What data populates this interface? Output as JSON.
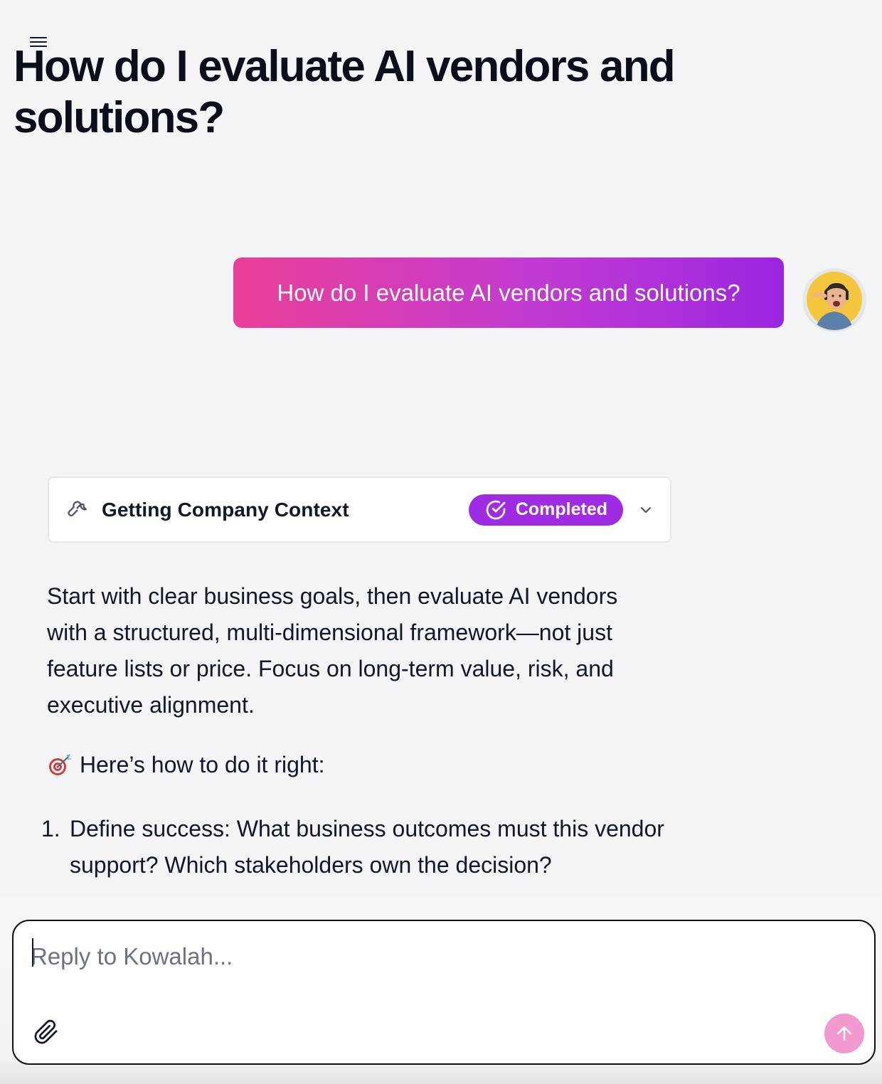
{
  "page": {
    "title": "How do I evaluate AI vendors and solutions?"
  },
  "header": {
    "menu_icon": "hamburger-menu-icon"
  },
  "conversation": {
    "user_message": "How do I evaluate AI vendors and solutions?",
    "user_avatar": "user-avatar-photo",
    "tool_call": {
      "icon": "wrench-icon",
      "label": "Getting Company Context",
      "status": "Completed",
      "status_icon": "check-circle-icon",
      "toggle_icon": "chevron-down-icon"
    },
    "answer_paragraph": "Start with clear business goals, then evaluate AI vendors with a structured, multi-dimensional framework—not just feature lists or price. Focus on long-term value, risk, and executive alignment.",
    "howto": {
      "emoji_icon": "direct-hit-target-icon",
      "text": "Here’s how to do it right:"
    },
    "steps": [
      {
        "number": "1.",
        "text": "Define success: What business outcomes must this vendor support? Which stakeholders own the decision?"
      }
    ]
  },
  "composer": {
    "placeholder": "Reply to Kowalah...",
    "value": "",
    "attach_icon": "paperclip-icon",
    "send_icon": "arrow-up-icon"
  },
  "colors": {
    "background": "#f3f4f6",
    "bubble_gradient_start": "#ea3f97",
    "bubble_gradient_end": "#9b26e0",
    "status_badge": "#9d2ce2",
    "send_button": "#f29ad0"
  }
}
